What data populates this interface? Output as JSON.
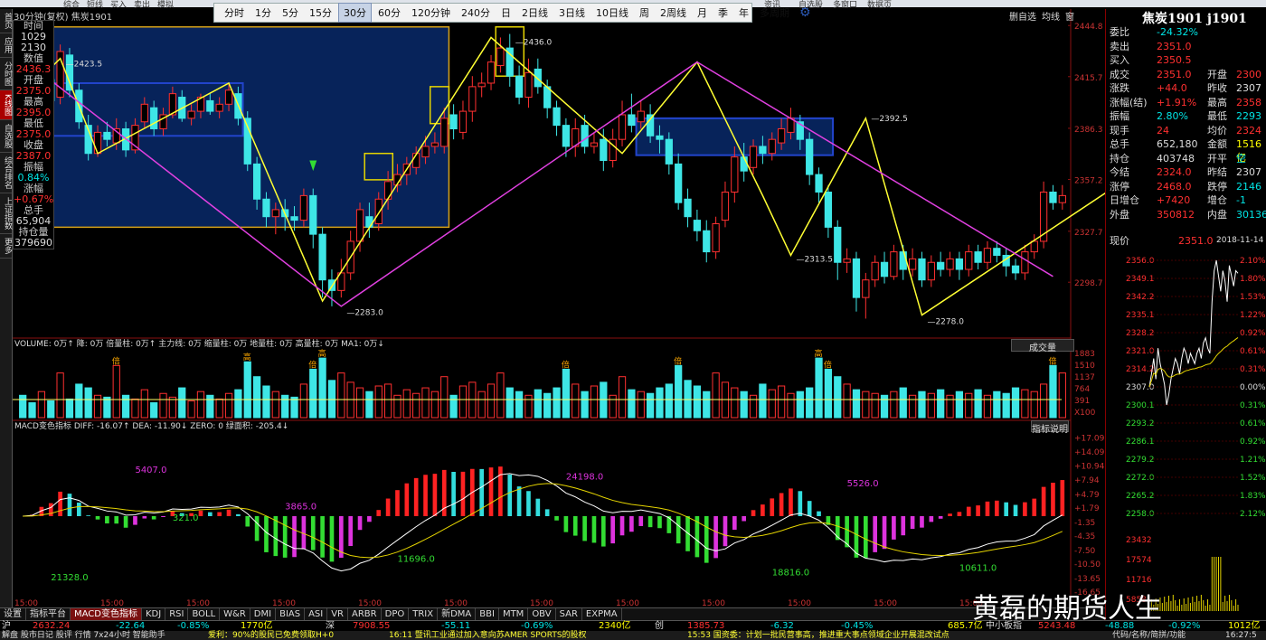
{
  "app_bar": {
    "items": [
      "综合",
      "短线",
      "买入",
      "卖出",
      "模拟"
    ],
    "right_items": [
      "资讯",
      "自选股",
      "多窗口",
      "数据页"
    ]
  },
  "chart_title": "30分钟(复权) 焦炭1901",
  "periods": [
    "分时",
    "1分",
    "5分",
    "15分",
    "30分",
    "60分",
    "120分钟",
    "240分",
    "日",
    "2日线",
    "3日线",
    "10日线",
    "周",
    "2周线",
    "月",
    "季",
    "年",
    "多周期"
  ],
  "active_period": "30分",
  "left_tabs": [
    "首页",
    "应用",
    "分时图",
    "K线图",
    "自选股",
    "综合排名",
    "上证指数",
    "更多"
  ],
  "active_left_tab": "K线图",
  "info_panel": [
    {
      "label": "时间",
      "value": "1029",
      "color": "#dddddd"
    },
    {
      "label": "",
      "value": "2130",
      "color": "#dddddd"
    },
    {
      "label": "数值",
      "value": "2436.3",
      "color": "#ff3030"
    },
    {
      "label": "开盘",
      "value": "2375.0",
      "color": "#ff3030"
    },
    {
      "label": "最高",
      "value": "2395.0",
      "color": "#ff3030"
    },
    {
      "label": "最低",
      "value": "2375.0",
      "color": "#ff3030"
    },
    {
      "label": "收盘",
      "value": "2387.0",
      "color": "#ff3030"
    },
    {
      "label": "振幅",
      "value": "0.84%",
      "color": "#00e5e5"
    },
    {
      "label": "涨幅",
      "value": "+0.67%",
      "color": "#ff3030"
    },
    {
      "label": "总手",
      "value": "65,904",
      "color": "#dddddd"
    },
    {
      "label": "持仓量",
      "value": "379690",
      "color": "#dddddd"
    }
  ],
  "toolbar_right": [
    "删自选",
    "均线",
    "窗"
  ],
  "price_axis": [
    "2444.8",
    "2415.7",
    "2386.3",
    "2357.2",
    "2327.7",
    "2298.7"
  ],
  "candles": [
    [
      2386,
      2380,
      2396,
      2376
    ],
    [
      2390,
      2384,
      2400,
      2381
    ],
    [
      2378,
      2404,
      2410,
      2374
    ],
    [
      2414,
      2402,
      2418,
      2396
    ],
    [
      2404,
      2430,
      2434,
      2400
    ],
    [
      2428,
      2408,
      2432,
      2404
    ],
    [
      2408,
      2390,
      2412,
      2386
    ],
    [
      2388,
      2372,
      2394,
      2368
    ],
    [
      2372,
      2384,
      2388,
      2370
    ],
    [
      2384,
      2380,
      2390,
      2376
    ],
    [
      2378,
      2386,
      2392,
      2374
    ],
    [
      2386,
      2374,
      2390,
      2370
    ],
    [
      2374,
      2388,
      2392,
      2372
    ],
    [
      2390,
      2400,
      2404,
      2386
    ],
    [
      2398,
      2386,
      2402,
      2382
    ],
    [
      2386,
      2394,
      2398,
      2382
    ],
    [
      2394,
      2406,
      2410,
      2392
    ],
    [
      2404,
      2392,
      2408,
      2390
    ],
    [
      2392,
      2396,
      2400,
      2388
    ],
    [
      2396,
      2404,
      2406,
      2392
    ],
    [
      2402,
      2396,
      2406,
      2394
    ],
    [
      2396,
      2400,
      2404,
      2392
    ],
    [
      2400,
      2408,
      2412,
      2396
    ],
    [
      2406,
      2392,
      2410,
      2388
    ],
    [
      2392,
      2366,
      2396,
      2362
    ],
    [
      2366,
      2346,
      2370,
      2340
    ],
    [
      2346,
      2336,
      2350,
      2330
    ],
    [
      2336,
      2340,
      2344,
      2326
    ],
    [
      2340,
      2336,
      2346,
      2328
    ],
    [
      2336,
      2334,
      2342,
      2328
    ],
    [
      2334,
      2348,
      2352,
      2330
    ],
    [
      2348,
      2326,
      2352,
      2318
    ],
    [
      2326,
      2300,
      2330,
      2290
    ],
    [
      2300,
      2294,
      2306,
      2285
    ],
    [
      2294,
      2304,
      2312,
      2290
    ],
    [
      2304,
      2322,
      2328,
      2300
    ],
    [
      2322,
      2340,
      2344,
      2316
    ],
    [
      2336,
      2330,
      2344,
      2324
    ],
    [
      2332,
      2346,
      2350,
      2328
    ],
    [
      2346,
      2356,
      2362,
      2340
    ],
    [
      2354,
      2360,
      2366,
      2350
    ],
    [
      2360,
      2366,
      2370,
      2354
    ],
    [
      2364,
      2372,
      2376,
      2360
    ],
    [
      2370,
      2376,
      2382,
      2366
    ],
    [
      2376,
      2378,
      2384,
      2372
    ],
    [
      2376,
      2392,
      2398,
      2372
    ],
    [
      2394,
      2386,
      2400,
      2380
    ],
    [
      2384,
      2396,
      2402,
      2380
    ],
    [
      2396,
      2410,
      2416,
      2390
    ],
    [
      2410,
      2412,
      2418,
      2404
    ],
    [
      2412,
      2424,
      2428,
      2408
    ],
    [
      2422,
      2432,
      2438,
      2418
    ],
    [
      2432,
      2416,
      2440,
      2410
    ],
    [
      2416,
      2404,
      2422,
      2400
    ],
    [
      2404,
      2418,
      2426,
      2398
    ],
    [
      2420,
      2410,
      2426,
      2406
    ],
    [
      2410,
      2398,
      2414,
      2392
    ],
    [
      2398,
      2388,
      2402,
      2382
    ],
    [
      2388,
      2376,
      2392,
      2370
    ],
    [
      2376,
      2386,
      2392,
      2370
    ],
    [
      2388,
      2376,
      2394,
      2372
    ],
    [
      2376,
      2378,
      2384,
      2372
    ],
    [
      2380,
      2368,
      2386,
      2362
    ],
    [
      2368,
      2380,
      2386,
      2364
    ],
    [
      2380,
      2394,
      2402,
      2376
    ],
    [
      2394,
      2388,
      2406,
      2384
    ],
    [
      2390,
      2396,
      2402,
      2386
    ],
    [
      2394,
      2382,
      2400,
      2378
    ],
    [
      2382,
      2380,
      2388,
      2372
    ],
    [
      2380,
      2366,
      2384,
      2360
    ],
    [
      2366,
      2344,
      2372,
      2340
    ],
    [
      2346,
      2336,
      2352,
      2330
    ],
    [
      2334,
      2328,
      2340,
      2322
    ],
    [
      2328,
      2316,
      2334,
      2310
    ],
    [
      2316,
      2332,
      2336,
      2312
    ],
    [
      2334,
      2350,
      2356,
      2330
    ],
    [
      2350,
      2370,
      2376,
      2344
    ],
    [
      2370,
      2362,
      2378,
      2356
    ],
    [
      2364,
      2376,
      2380,
      2360
    ],
    [
      2376,
      2372,
      2382,
      2366
    ],
    [
      2372,
      2380,
      2384,
      2368
    ],
    [
      2378,
      2386,
      2392,
      2374
    ],
    [
      2384,
      2392,
      2398,
      2380
    ],
    [
      2390,
      2380,
      2394,
      2374
    ],
    [
      2380,
      2360,
      2384,
      2354
    ],
    [
      2360,
      2350,
      2364,
      2344
    ],
    [
      2350,
      2330,
      2354,
      2324
    ],
    [
      2330,
      2310,
      2334,
      2300
    ],
    [
      2310,
      2312,
      2318,
      2304
    ],
    [
      2312,
      2290,
      2316,
      2282
    ],
    [
      2290,
      2300,
      2304,
      2278
    ],
    [
      2300,
      2310,
      2314,
      2296
    ],
    [
      2310,
      2302,
      2316,
      2298
    ],
    [
      2302,
      2316,
      2320,
      2300
    ],
    [
      2316,
      2306,
      2320,
      2300
    ],
    [
      2306,
      2312,
      2318,
      2302
    ],
    [
      2312,
      2300,
      2316,
      2296
    ],
    [
      2300,
      2310,
      2314,
      2296
    ],
    [
      2310,
      2306,
      2316,
      2302
    ],
    [
      2306,
      2312,
      2316,
      2302
    ],
    [
      2312,
      2306,
      2316,
      2300
    ],
    [
      2306,
      2316,
      2320,
      2302
    ],
    [
      2316,
      2310,
      2320,
      2306
    ],
    [
      2310,
      2318,
      2322,
      2306
    ],
    [
      2318,
      2314,
      2322,
      2310
    ],
    [
      2314,
      2308,
      2318,
      2302
    ],
    [
      2308,
      2304,
      2312,
      2300
    ],
    [
      2304,
      2316,
      2320,
      2300
    ],
    [
      2316,
      2322,
      2326,
      2312
    ],
    [
      2322,
      2350,
      2356,
      2318
    ],
    [
      2350,
      2344,
      2354,
      2340
    ],
    [
      2344,
      2348,
      2354,
      2340
    ]
  ],
  "annotations": [
    "2423.5",
    "2283.0",
    "2436.0",
    "2392.5",
    "2313.5",
    "2278.0"
  ],
  "volume": {
    "label": "VOLUME: 0万↑ 降: 0万 倍量柱: 0万↑ 主力线: 0万 缩量柱: 0万 地量柱: 0万 高量柱: 0万 MA1: 0万↓",
    "button": "成交量",
    "axis": [
      "1883",
      "1510",
      "1137",
      "764",
      "391",
      "X100"
    ],
    "marker": "高",
    "marker2": "倍",
    "values": [
      60,
      40,
      70,
      45,
      120,
      50,
      90,
      80,
      60,
      55,
      140,
      60,
      50,
      75,
      40,
      65,
      55,
      80,
      45,
      70,
      60,
      50,
      65,
      75,
      150,
      110,
      85,
      70,
      60,
      55,
      90,
      130,
      160,
      100,
      120,
      95,
      80,
      70,
      85,
      90,
      60,
      75,
      65,
      80,
      70,
      110,
      60,
      85,
      95,
      70,
      90,
      120,
      80,
      70,
      60,
      75,
      65,
      80,
      130,
      90,
      70,
      85,
      95,
      60,
      110,
      75,
      70,
      65,
      80,
      90,
      140,
      100,
      85,
      70,
      120,
      95,
      80,
      70,
      60,
      90,
      75,
      85,
      65,
      70,
      80,
      160,
      130,
      110,
      90,
      75,
      70,
      65,
      60,
      70,
      80,
      60,
      70,
      65,
      75,
      60,
      70,
      65,
      75,
      60,
      70,
      65,
      80,
      75,
      70,
      90,
      140,
      120,
      85
    ]
  },
  "macd": {
    "label": "MACD变色指标 DIFF: -16.07↑ DEA: -11.90↓ ZERO: 0 绿面积: -205.4↓",
    "button": "指标说明",
    "axis": [
      "+17.09",
      "+14.09",
      "+10.94",
      "+7.94",
      "+4.79",
      "+1.79",
      "-1.35",
      "-4.35",
      "-7.50",
      "-10.50",
      "-13.65",
      "-16.65"
    ],
    "area_labels": [
      "5407.0",
      "321.0",
      "3865.0",
      "21328.0",
      "11696.0",
      "24198.0",
      "5526.0",
      "18816.0",
      "10611.0"
    ]
  },
  "time_axis": [
    "15:00",
    "15:00",
    "15:00",
    "15:00",
    "15:00",
    "15:00",
    "15:00",
    "15:00",
    "15:00",
    "15:00",
    "15:00",
    "15:00"
  ],
  "tabs": [
    "设置",
    "指标平台",
    "MACD变色指标",
    "KDJ",
    "RSI",
    "BOLL",
    "W&R",
    "DMI",
    "BIAS",
    "ASI",
    "VR",
    "ARBR",
    "DPO",
    "TRIX",
    "新DMA",
    "BBI",
    "MTM",
    "OBV",
    "SAR",
    "EXPMA"
  ],
  "active_tab": "MACD变色指标",
  "right_panel": {
    "title": "焦炭1901 j1901",
    "rows": [
      {
        "l": "委比",
        "v": "-24.32%",
        "c": "#00e5e5",
        "l2": "",
        "v2": "",
        "c2": "#ddd"
      },
      {
        "l": "卖出",
        "v": "2351.0",
        "c": "#ff3030",
        "l2": "",
        "v2": "",
        "c2": "#ddd"
      },
      {
        "l": "买入",
        "v": "2350.5",
        "c": "#ff3030",
        "l2": "",
        "v2": "",
        "c2": "#ddd"
      },
      {
        "l": "成交",
        "v": "2351.0",
        "c": "#ff3030",
        "l2": "开盘",
        "v2": "2300",
        "c2": "#ff3030"
      },
      {
        "l": "涨跌",
        "v": "+44.0",
        "c": "#ff3030",
        "l2": "昨收",
        "v2": "2307",
        "c2": "#ddd"
      },
      {
        "l": "涨幅(结)",
        "v": "+1.91%",
        "c": "#ff3030",
        "l2": "最高",
        "v2": "2358",
        "c2": "#ff3030"
      },
      {
        "l": "振幅",
        "v": "2.80%",
        "c": "#00e5e5",
        "l2": "最低",
        "v2": "2293",
        "c2": "#00e5e5"
      },
      {
        "l": "现手",
        "v": "24",
        "c": "#ff3030",
        "l2": "均价",
        "v2": "2324",
        "c2": "#ff3030"
      },
      {
        "l": "总手",
        "v": "652,180",
        "c": "#dddddd",
        "l2": "金额",
        "v2": "1516亿",
        "c2": "#ffff00"
      },
      {
        "l": "持仓",
        "v": "403748",
        "c": "#dddddd",
        "l2": "开平",
        "v2": "空",
        "c2": "#00e5e5"
      },
      {
        "l": "今结",
        "v": "2324.0",
        "c": "#ff3030",
        "l2": "昨结",
        "v2": "2307",
        "c2": "#ddd"
      },
      {
        "l": "涨停",
        "v": "2468.0",
        "c": "#ff3030",
        "l2": "跌停",
        "v2": "2146",
        "c2": "#00e5e5"
      },
      {
        "l": "日增仓",
        "v": "+7420",
        "c": "#ff3030",
        "l2": "增仓",
        "v2": "-1",
        "c2": "#00e5e5"
      },
      {
        "l": "外盘",
        "v": "350812",
        "c": "#ff3030",
        "l2": "内盘",
        "v2": "30136",
        "c2": "#00e5e5"
      }
    ],
    "now_label": "现价",
    "now_value": "2351.0",
    "now_date": "2018-11-14",
    "mini_axis": [
      "2356.0",
      "2349.1",
      "2342.2",
      "2335.1",
      "2328.2",
      "2321.0",
      "2314.2",
      "2307.0",
      "2300.1",
      "2293.2",
      "2286.1",
      "2279.2",
      "2272.0",
      "2265.2",
      "2258.0"
    ],
    "mini_pct": [
      "2.10%",
      "1.80%",
      "1.53%",
      "1.22%",
      "0.92%",
      "0.61%",
      "0.31%",
      "0.00%",
      "0.31%",
      "0.61%",
      "0.92%",
      "1.21%",
      "1.52%",
      "1.83%",
      "2.12%"
    ],
    "mini_vol_axis": [
      "23432",
      "17574",
      "11716",
      "5858"
    ]
  },
  "index_bar": [
    {
      "text": "沪",
      "c": "#ddd"
    },
    {
      "text": "2632.24",
      "c": "#ff3030"
    },
    {
      "text": "-22.64",
      "c": "#00e5e5"
    },
    {
      "text": "-0.85%",
      "c": "#00e5e5"
    },
    {
      "text": "1770亿",
      "c": "#ffff00"
    },
    {
      "text": "深",
      "c": "#ddd"
    },
    {
      "text": "7908.55",
      "c": "#ff3030"
    },
    {
      "text": "-55.11",
      "c": "#00e5e5"
    },
    {
      "text": "-0.69%",
      "c": "#00e5e5"
    },
    {
      "text": "2340亿",
      "c": "#ffff00"
    },
    {
      "text": "创",
      "c": "#ddd"
    },
    {
      "text": "1385.73",
      "c": "#ff3030"
    },
    {
      "text": "-6.32",
      "c": "#00e5e5"
    },
    {
      "text": "-0.45%",
      "c": "#00e5e5"
    },
    {
      "text": "685.7亿",
      "c": "#ffff00"
    },
    {
      "text": "中小板指",
      "c": "#ddd"
    },
    {
      "text": "5243.48",
      "c": "#ff3030"
    },
    {
      "text": "-48.88",
      "c": "#00e5e5"
    },
    {
      "text": "-0.92%",
      "c": "#00e5e5"
    },
    {
      "text": "1012亿",
      "c": "#ffff00"
    }
  ],
  "news": [
    "解盘 股市日记 股评 行情 7x24小时 智能助手",
    "爱利：90%的股民已免费领取H+0",
    "16:11 暨讯工业通过加入意向苏AMER SPORTS的股权",
    "15:53 国资委：计划一批民营事高，推进重大事点领域企业开展混改试点",
    "代码/名称/简拼/功能",
    "16:27:5"
  ],
  "watermark": "黄磊的期货人生"
}
